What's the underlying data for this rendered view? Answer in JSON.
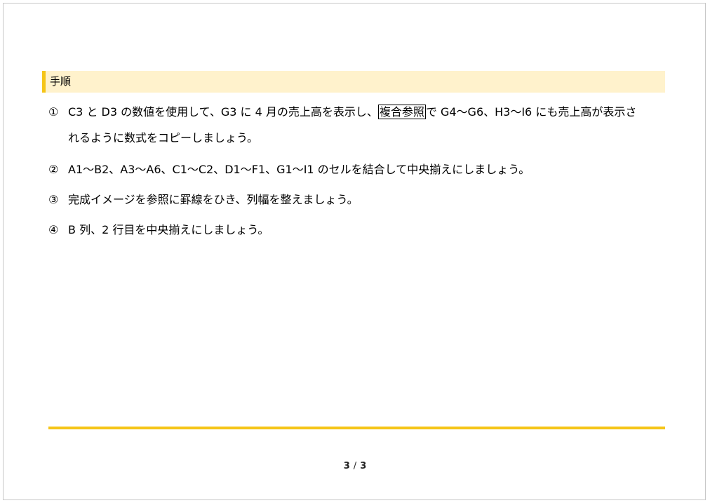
{
  "section": {
    "title": "手順"
  },
  "steps": [
    {
      "number": "①",
      "before": "C3 と D3 の数値を使用して、G3 に 4 月の売上高を表示し、",
      "boxed": "複合参照",
      "after": "で G4〜G6、H3〜I6 にも売上高が表示さ",
      "continuation": "れるように数式をコピーしましょう。"
    },
    {
      "number": "②",
      "text": "A1〜B2、A3〜A6、C1〜C2、D1〜F1、G1〜I1 のセルを結合して中央揃えにしましょう。"
    },
    {
      "number": "③",
      "text": "完成イメージを参照に罫線をひき、列幅を整えましょう。"
    },
    {
      "number": "④",
      "text": "B 列、2 行目を中央揃えにしましょう。"
    }
  ],
  "footer": {
    "current_page": "3",
    "separator": "/",
    "total_pages": "3"
  },
  "colors": {
    "accent": "#f5c518",
    "header_background": "#fff2cc"
  }
}
